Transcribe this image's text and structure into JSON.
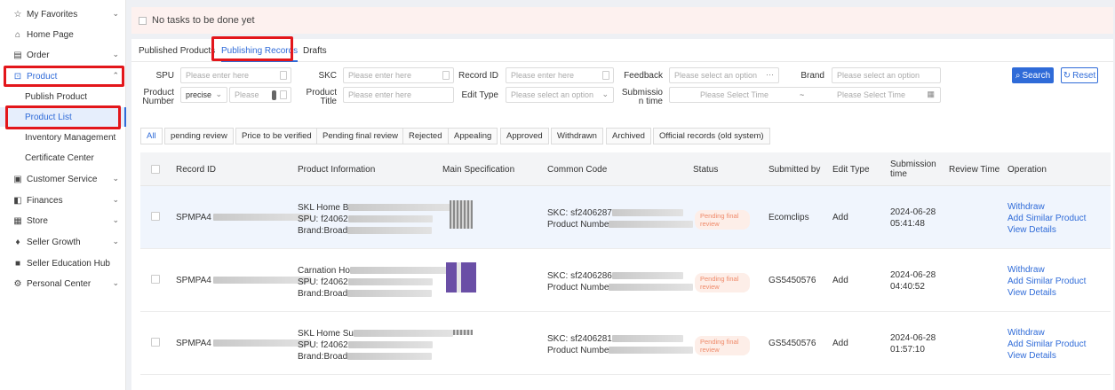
{
  "sidebar": {
    "items": [
      {
        "icon": "star-icon",
        "label": "My Favorites"
      },
      {
        "icon": "home-icon",
        "label": "Home Page"
      },
      {
        "icon": "order-icon",
        "label": "Order"
      },
      {
        "icon": "product-icon",
        "label": "Product"
      },
      {
        "icon": "customer-service-icon",
        "label": "Customer Service"
      },
      {
        "icon": "finances-icon",
        "label": "Finances"
      },
      {
        "icon": "store-icon",
        "label": "Store"
      },
      {
        "icon": "growth-icon",
        "label": "Seller Growth"
      },
      {
        "icon": "education-icon",
        "label": "Seller Education Hub"
      },
      {
        "icon": "personal-icon",
        "label": "Personal Center"
      }
    ],
    "product_sub": [
      "Publish Product",
      "Product List",
      "Inventory Management",
      "Certificate Center"
    ]
  },
  "banner": {
    "text": "No tasks to be done yet"
  },
  "top_tabs": [
    "Published Products",
    "Publishing Records",
    "Drafts"
  ],
  "filters": {
    "spu": {
      "label": "SPU",
      "placeholder": "Please enter here"
    },
    "skc": {
      "label": "SKC",
      "placeholder": "Please enter here"
    },
    "record_id": {
      "label": "Record ID",
      "placeholder": "Please enter here"
    },
    "feedback": {
      "label": "Feedback",
      "placeholder": "Please select an option"
    },
    "brand": {
      "label": "Brand",
      "placeholder": "Please select an option"
    },
    "product_number": {
      "label1": "Product",
      "label2": "Number",
      "mode": "precise",
      "placeholder": "Please"
    },
    "product_title": {
      "label1": "Product",
      "label2": "Title",
      "placeholder": "Please enter here"
    },
    "edit_type": {
      "label": "Edit Type",
      "placeholder": "Please select an option"
    },
    "submission_time": {
      "label1": "Submissio",
      "label2": "n time",
      "start": "Please Select Time",
      "sep": "~",
      "end": "Please Select Time"
    }
  },
  "buttons": {
    "search": "Search",
    "reset": "Reset"
  },
  "status_tabs": [
    "All",
    "pending review",
    "Price to be verified",
    "Pending final review",
    "Rejected",
    "Appealing",
    "Approved",
    "Withdrawn",
    "Archived",
    "Official records (old system)"
  ],
  "columns": [
    "Record ID",
    "Product Information",
    "Main Specification",
    "Common Code",
    "Status",
    "Submitted by",
    "Edit Type",
    "Submission time",
    "Review Time",
    "Operation"
  ],
  "rows": [
    {
      "record_id": "SPMPA4",
      "info1": "SKL Home B",
      "info2": "SPU: f24062",
      "info3": "Brand:Broad",
      "skc": "SKC: sf2406287",
      "pnum": "Product Numbe",
      "status": "Pending final review",
      "submitted_by": "Ecomclips",
      "edit_type": "Add",
      "date": "2024-06-28",
      "time": "05:41:48"
    },
    {
      "record_id": "SPMPA4",
      "info1": "Carnation Ho",
      "info2": "SPU: f24062",
      "info3": "Brand:Broad",
      "skc": "SKC: sf2406286",
      "pnum": "Product Numbe",
      "status": "Pending final review",
      "submitted_by": "GS5450576",
      "edit_type": "Add",
      "date": "2024-06-28",
      "time": "04:40:52"
    },
    {
      "record_id": "SPMPA4",
      "info1": "SKL Home Su",
      "info2": "SPU: f24062",
      "info3": "Brand:Broad",
      "skc": "SKC: sf2406281",
      "pnum": "Product Numbe",
      "status": "Pending final review",
      "submitted_by": "GS5450576",
      "edit_type": "Add",
      "date": "2024-06-28",
      "time": "01:57:10"
    }
  ],
  "operations": [
    "Withdraw",
    "Add Similar Product",
    "View Details"
  ]
}
